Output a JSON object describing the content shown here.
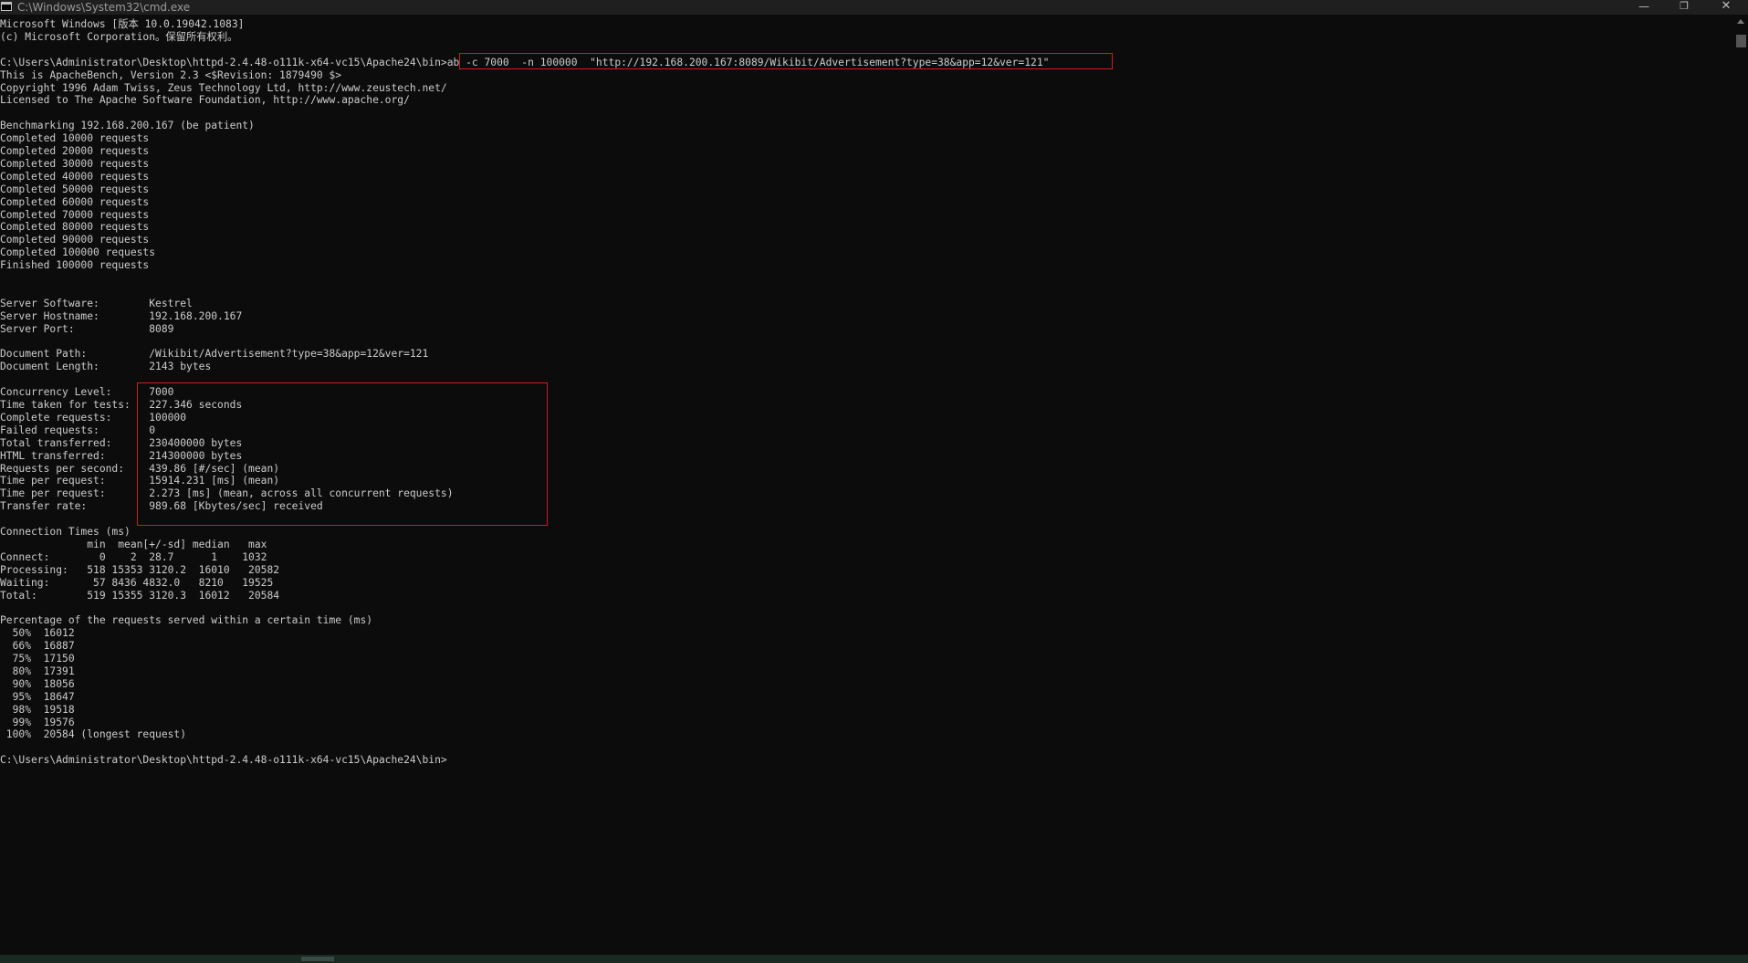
{
  "window": {
    "title": "C:\\Windows\\System32\\cmd.exe",
    "controls": {
      "minimize": "—",
      "maximize": "❐",
      "close": "✕"
    }
  },
  "console": {
    "lines": [
      "Microsoft Windows [版本 10.0.19042.1083]",
      "(c) Microsoft Corporation。保留所有权利。",
      "",
      "C:\\Users\\Administrator\\Desktop\\httpd-2.4.48-o111k-x64-vc15\\Apache24\\bin>ab -c 7000  -n 100000  \"http://192.168.200.167:8089/Wikibit/Advertisement?type=38&app=12&ver=121\"",
      "This is ApacheBench, Version 2.3 <$Revision: 1879490 $>",
      "Copyright 1996 Adam Twiss, Zeus Technology Ltd, http://www.zeustech.net/",
      "Licensed to The Apache Software Foundation, http://www.apache.org/",
      "",
      "Benchmarking 192.168.200.167 (be patient)",
      "Completed 10000 requests",
      "Completed 20000 requests",
      "Completed 30000 requests",
      "Completed 40000 requests",
      "Completed 50000 requests",
      "Completed 60000 requests",
      "Completed 70000 requests",
      "Completed 80000 requests",
      "Completed 90000 requests",
      "Completed 100000 requests",
      "Finished 100000 requests",
      "",
      "",
      "Server Software:        Kestrel",
      "Server Hostname:        192.168.200.167",
      "Server Port:            8089",
      "",
      "Document Path:          /Wikibit/Advertisement?type=38&app=12&ver=121",
      "Document Length:        2143 bytes",
      "",
      "Concurrency Level:      7000",
      "Time taken for tests:   227.346 seconds",
      "Complete requests:      100000",
      "Failed requests:        0",
      "Total transferred:      230400000 bytes",
      "HTML transferred:       214300000 bytes",
      "Requests per second:    439.86 [#/sec] (mean)",
      "Time per request:       15914.231 [ms] (mean)",
      "Time per request:       2.273 [ms] (mean, across all concurrent requests)",
      "Transfer rate:          989.68 [Kbytes/sec] received",
      "",
      "Connection Times (ms)",
      "              min  mean[+/-sd] median   max",
      "Connect:        0    2  28.7      1    1032",
      "Processing:   518 15353 3120.2  16010   20582",
      "Waiting:       57 8436 4832.0   8210   19525",
      "Total:        519 15355 3120.3  16012   20584",
      "",
      "Percentage of the requests served within a certain time (ms)",
      "  50%  16012",
      "  66%  16887",
      "  75%  17150",
      "  80%  17391",
      "  90%  18056",
      "  95%  18647",
      "  98%  19518",
      "  99%  19576",
      " 100%  20584 (longest request)",
      "",
      "C:\\Users\\Administrator\\Desktop\\httpd-2.4.48-o111k-x64-vc15\\Apache24\\bin>"
    ]
  }
}
